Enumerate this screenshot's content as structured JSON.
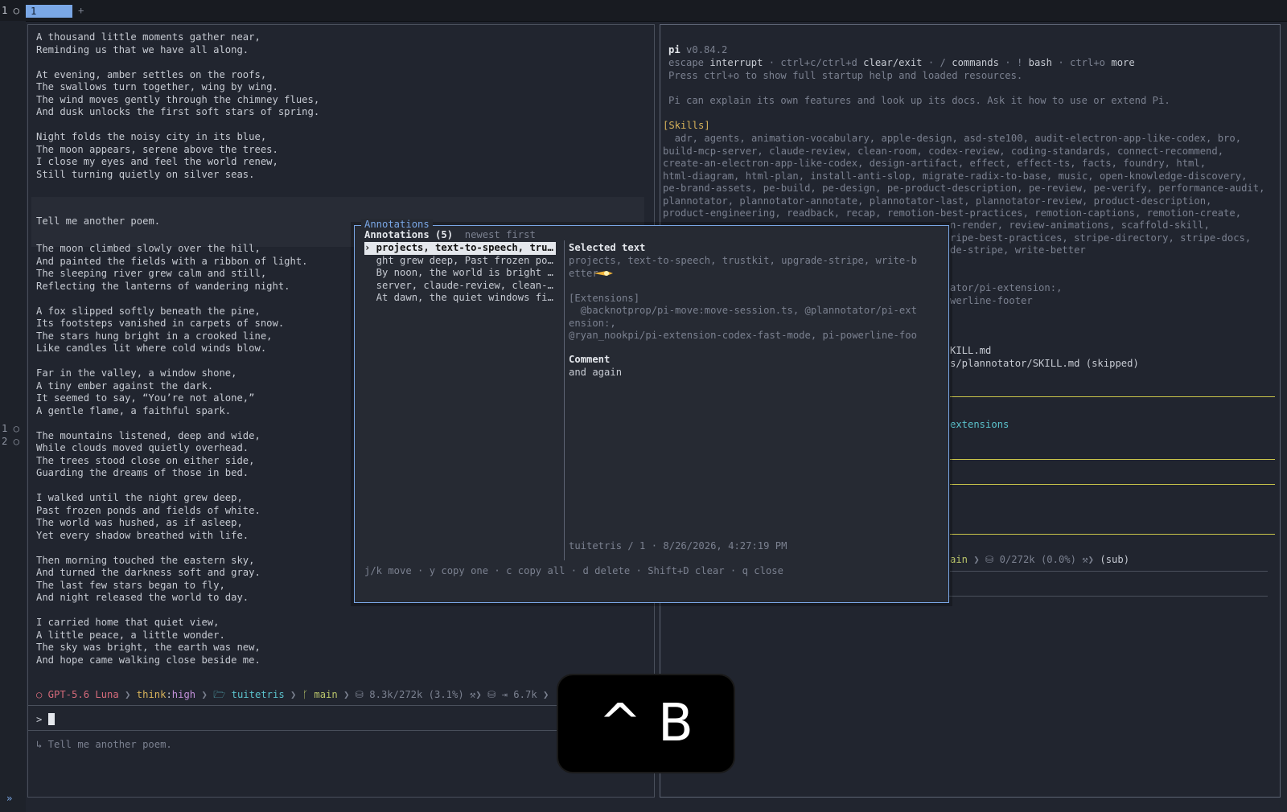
{
  "top_bar": {
    "session_number": "1 ○",
    "active_tab": "1",
    "new_tab": "+"
  },
  "gutter": {
    "mark1": "1 ○",
    "mark2": "2 ○",
    "chevron": "»"
  },
  "left_pane": {
    "poem1": [
      "A thousand little moments gather near,",
      "Reminding us that we have all along.",
      "",
      "At evening, amber settles on the roofs,",
      "The swallows turn together, wing by wing.",
      "The wind moves gently through the chimney flues,",
      "And dusk unlocks the first soft stars of spring.",
      "",
      "Night folds the noisy city in its blue,",
      "The moon appears, serene above the trees.",
      "I close my eyes and feel the world renew,",
      "Still turning quietly on silver seas."
    ],
    "user_message": "Tell me another poem.",
    "poem2": [
      "The moon climbed slowly over the hill,",
      "And painted the fields with a ribbon of light.",
      "The sleeping river grew calm and still,",
      "Reflecting the lanterns of wandering night.",
      "",
      "A fox slipped softly beneath the pine,",
      "Its footsteps vanished in carpets of snow.",
      "The stars hung bright in a crooked line,",
      "Like candles lit where cold winds blow.",
      "",
      "Far in the valley, a window shone,",
      "A tiny ember against the dark.",
      "It seemed to say, “You’re not alone,”",
      "A gentle flame, a faithful spark.",
      "",
      "The mountains listened, deep and wide,",
      "While clouds moved quietly overhead.",
      "The trees stood close on either side,",
      "Guarding the dreams of those in bed.",
      "",
      "I walked until the night grew deep,",
      "Past frozen ponds and fields of white.",
      "The world was hushed, as if asleep,",
      "Yet every shadow breathed with life.",
      "",
      "Then morning touched the eastern sky,",
      "And turned the darkness soft and gray.",
      "The last few stars began to fly,",
      "And night released the world to day.",
      "",
      "I carried home that quiet view,",
      "A little peace, a little wonder.",
      "The sky was bright, the earth was new,",
      "And hope came walking close beside me."
    ],
    "status": {
      "model": "○ GPT-5.6 Luna",
      "think_label": "think",
      "think_colon": ":",
      "think_value": "high",
      "folder": "🗁 tuitetris",
      "branch": "ᚴ main",
      "tokens": "⛁ 8.3k/272k (3.1%)",
      "tool": "⚒",
      "cache": "⛁ ⇥ 6.7k"
    },
    "prompt": ">",
    "history_hint": "↳ Tell me another poem."
  },
  "right_pane": {
    "header_name": "pi",
    "header_version": "v0.84.2",
    "hint_parts": [
      {
        "k": "escape",
        "v": " interrupt"
      },
      {
        "k": " · ctrl+c/ctrl+d",
        "v": " clear/exit"
      },
      {
        "k": " · /",
        "v": " commands"
      },
      {
        "k": " · !",
        "v": " bash"
      },
      {
        "k": " · ctrl+o",
        "v": " more"
      }
    ],
    "startup_hint": "Press ctrl+o to show full startup help and loaded resources.",
    "explain_hint": "Pi can explain its own features and look up its docs. Ask it how to use or extend Pi.",
    "skills_heading": "[Skills]",
    "skills_lines": [
      "  adr, agents, animation-vocabulary, apple-design, asd-ste100, audit-electron-app-like-codex, bro,",
      "build-mcp-server, claude-review, clean-room, codex-review, coding-standards, connect-recommend,",
      "create-an-electron-app-like-codex, design-artifact, effect, effect-ts, facts, foundry, html,",
      "html-diagram, html-plan, install-anti-slop, migrate-radix-to-base, music, open-knowledge-discovery,",
      "pe-brand-assets, pe-build, pe-design, pe-product-description, pe-review, pe-verify, performance-audit,",
      "plannotator, plannotator-annotate, plannotator-last, plannotator-review, product-description,",
      "product-engineering, readback, recap, remotion-best-practices, remotion-captions, remotion-create,",
      "n-render, review-animations, scaffold-skill,",
      "ripe-best-practices, stripe-directory, stripe-docs,",
      "de-stripe, write-better"
    ],
    "ext_lines": [
      "ator/pi-extension:,",
      "werline-footer"
    ],
    "skill_file_lines": [
      "KILL.md",
      "s/plannotator/SKILL.md (skipped)"
    ],
    "extensions_word": "extensions",
    "status_branch": "ain",
    "status_tokens": "⛁ 0/272k (0.0%)",
    "status_tool": "⚒",
    "status_sub": "(sub)"
  },
  "modal": {
    "title": "Annotations",
    "list_heading": "Annotations (5)",
    "sort_label": "newest first",
    "items": [
      "› projects, text-to-speech, tru…",
      "  ght grew deep, Past frozen po…",
      "  By noon, the world is bright …",
      "  server, claude-review, clean-…",
      "  At dawn, the quiet windows fi…"
    ],
    "selected_heading": "Selected text",
    "selected_lines": [
      "projects, text-to-speech, trustkit, upgrade-stripe, write-b",
      "etter",
      "",
      "[Extensions]",
      "  @backnotprop/pi-move:move-session.ts, @plannotator/pi-ext",
      "ension:,",
      "@ryan_nookpi/pi-extension-codex-fast-mode, pi-powerline-foo"
    ],
    "comment_heading": "Comment",
    "comment_text": "and again",
    "meta": "tuitetris / 1 · 8/26/2026, 4:27:19 PM",
    "footer": "j/k move · y copy one · c copy all · d delete · Shift+D clear · q close"
  },
  "key_overlay": {
    "text": "^ B"
  },
  "colors": {
    "background": "#21252f",
    "accent_blue": "#7aa7e6",
    "skill_yellow": "#d7b25a",
    "rule_yellow": "#c9c44a",
    "folder_cyan": "#5bc2cc",
    "branch_green": "#b9c46a",
    "think_purple": "#c18fd8"
  }
}
